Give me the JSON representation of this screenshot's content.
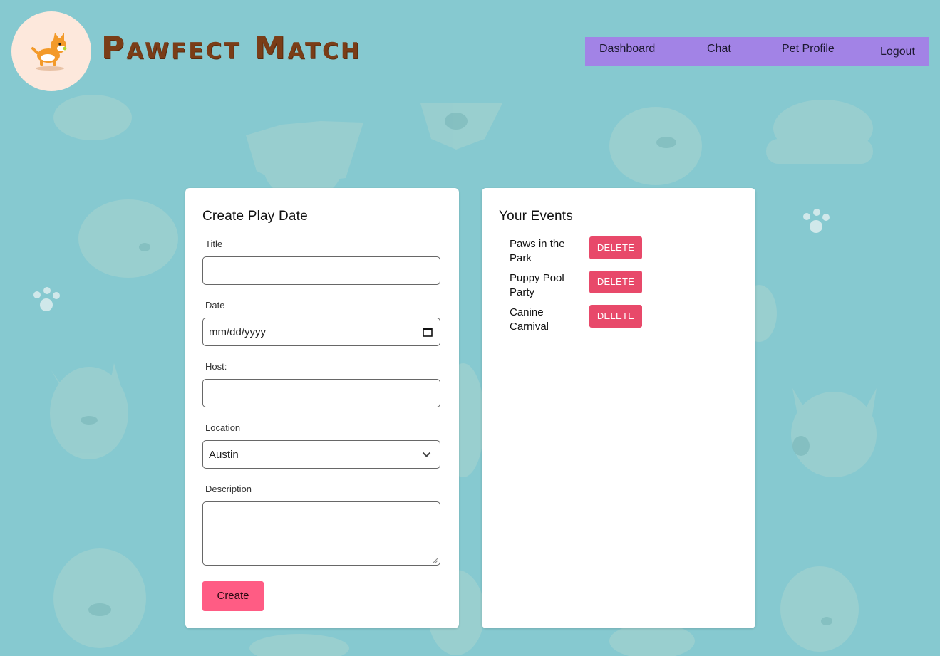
{
  "brand": {
    "name": "Pawfect Match"
  },
  "nav": {
    "items": [
      "Dashboard",
      "Chat",
      "Pet Profile",
      "Logout"
    ]
  },
  "create_form": {
    "title": "Create Play Date",
    "title_label": "Title",
    "title_value": "",
    "date_label": "Date",
    "date_value": "mm/dd/yyyy",
    "host_label": "Host:",
    "host_value": "",
    "location_label": "Location",
    "location_value": "Austin",
    "description_label": "Description",
    "description_value": "",
    "create_label": "Create"
  },
  "events": {
    "title": "Your Events",
    "delete_label": "DELETE",
    "items": [
      {
        "name": "Paws in the Park"
      },
      {
        "name": "Puppy Pool Party"
      },
      {
        "name": "Canine Carnival"
      }
    ]
  },
  "colors": {
    "background": "#86c9d0",
    "nav": "#a283e6",
    "create_button": "#ff5c84",
    "delete_button": "#e8496a",
    "brand_text": "#7a3d17"
  },
  "icons": [
    "corgi-logo-icon",
    "calendar-icon",
    "chevron-down-icon",
    "dog-pattern"
  ]
}
